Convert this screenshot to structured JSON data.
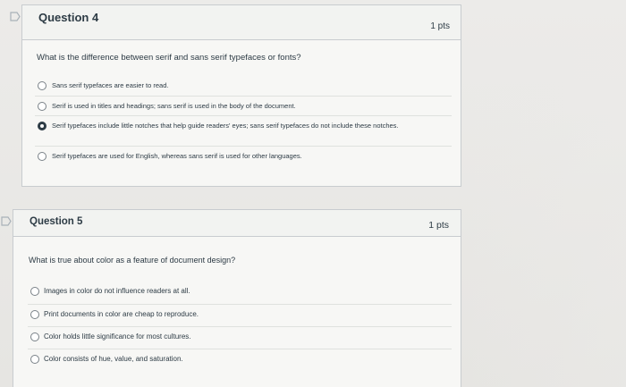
{
  "questions": [
    {
      "title": "Question 4",
      "points": "1 pts",
      "text": "What is the difference between serif and sans serif typefaces or fonts?",
      "answers": [
        {
          "label": "Sans serif typefaces are easier to read.",
          "selected": false
        },
        {
          "label": "Serif is used in titles and headings; sans serif is used in the body of the document.",
          "selected": false
        },
        {
          "label": "Serif typefaces include little notches that help guide readers' eyes; sans serif typefaces do not include these notches.",
          "selected": true
        },
        {
          "label": "Serif typefaces are used for English, whereas sans serif is used for other languages.",
          "selected": false
        }
      ]
    },
    {
      "title": "Question 5",
      "points": "1 pts",
      "text": "What is true about color as a feature of document design?",
      "answers": [
        {
          "label": "Images in color do not influence readers at all.",
          "selected": false
        },
        {
          "label": "Print documents in color are cheap to reproduce.",
          "selected": false
        },
        {
          "label": "Color holds little significance for most cultures.",
          "selected": false
        },
        {
          "label": "Color consists of hue, value, and saturation.",
          "selected": false
        }
      ]
    }
  ],
  "icons": {
    "flag": "flag-icon"
  },
  "colors": {
    "text": "#2d3b45",
    "border": "#c8cccf",
    "background": "#e9e9e7",
    "flag": "#a9b2b9"
  }
}
